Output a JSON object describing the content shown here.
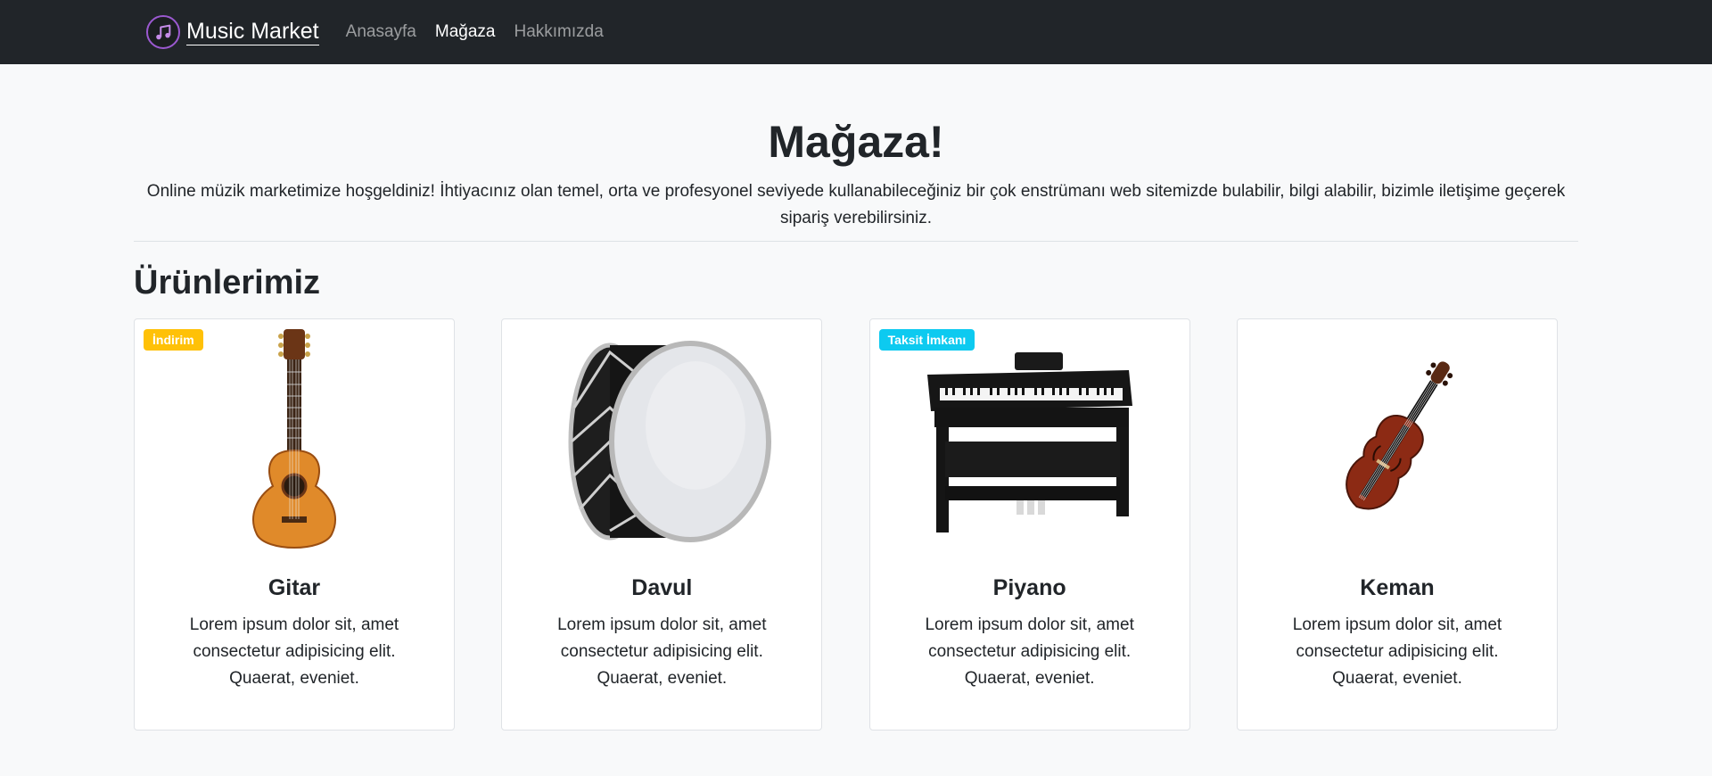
{
  "brand": {
    "name": "Music Market",
    "logo_icon": "music-note-icon",
    "accent": "#9b59d0"
  },
  "nav": {
    "items": [
      {
        "label": "Anasayfa",
        "active": false
      },
      {
        "label": "Mağaza",
        "active": true
      },
      {
        "label": "Hakkımızda",
        "active": false
      }
    ]
  },
  "hero": {
    "title": "Mağaza!",
    "description": "Online müzik marketimize hoşgeldiniz! İhtiyacınız olan temel, orta ve profesyonel seviyede kullanabileceğiniz bir çok enstrümanı web sitemizde bulabilir, bilgi alabilir, bizimle iletişime geçerek sipariş verebilirsiniz."
  },
  "products": {
    "title": "Ürünlerimiz",
    "items": [
      {
        "name": "Gitar",
        "image": "guitar-image",
        "badge": "İndirim",
        "badge_color": "#ffc107",
        "text": "Lorem ipsum dolor sit, amet consectetur adipisicing elit. Quaerat, eveniet."
      },
      {
        "name": "Davul",
        "image": "drum-image",
        "badge": "",
        "badge_color": "",
        "text": "Lorem ipsum dolor sit, amet consectetur adipisicing elit. Quaerat, eveniet."
      },
      {
        "name": "Piyano",
        "image": "piano-image",
        "badge": "Taksit İmkanı",
        "badge_color": "#0dcaf0",
        "text": "Lorem ipsum dolor sit, amet consectetur adipisicing elit. Quaerat, eveniet."
      },
      {
        "name": "Keman",
        "image": "violin-image",
        "badge": "",
        "badge_color": "",
        "text": "Lorem ipsum dolor sit, amet consectetur adipisicing elit. Quaerat, eveniet."
      }
    ]
  }
}
